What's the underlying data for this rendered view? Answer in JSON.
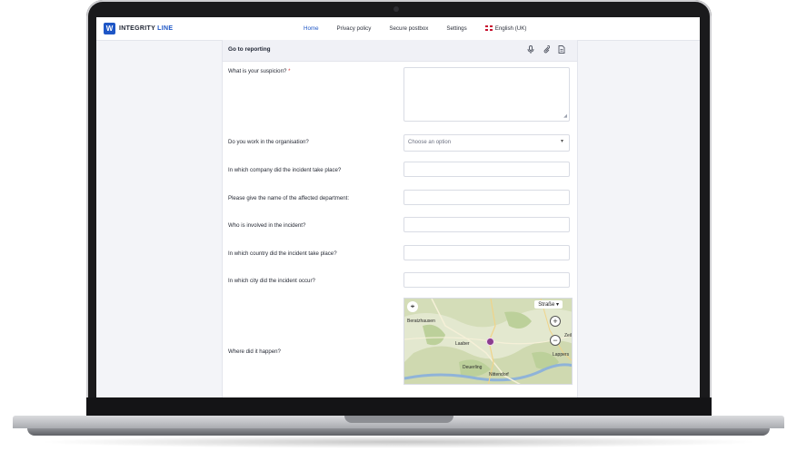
{
  "app": {
    "logo_mark": "W",
    "logo_word1": "INTEGRITY",
    "logo_word2": "LINE"
  },
  "nav": {
    "items": [
      {
        "label": "Home",
        "active": true
      },
      {
        "label": "Privacy policy"
      },
      {
        "label": "Secure postbox"
      },
      {
        "label": "Settings"
      }
    ],
    "language": "English (UK)"
  },
  "form": {
    "title": "Go to reporting",
    "header_icons": [
      "microphone-icon",
      "paperclip-icon",
      "document-icon"
    ],
    "q_suspicion": "What is your suspicion?",
    "required_mark": "*",
    "q_work": "Do you work in the organisation?",
    "work_placeholder": "Choose an option",
    "q_company": "In which company did the incident take place?",
    "q_department": "Please give the name of the affected department:",
    "q_involved": "Who is involved in the incident?",
    "q_country": "In which country did the incident take place?",
    "q_city": "In which city did the incident occur?",
    "q_where": "Where did it happen?"
  },
  "map": {
    "layer": "Straße",
    "zoom_in": "+",
    "zoom_out": "−",
    "labels": {
      "place1": "Beratzhausen",
      "place2": "Laaber",
      "place3": "Deuerling",
      "place4": "Nittendorf",
      "place5": "Lappers",
      "place6": "Zeil"
    }
  },
  "colors": {
    "accent": "#1e56c6",
    "marker": "#8a3d8f",
    "required": "#e03a3a"
  }
}
